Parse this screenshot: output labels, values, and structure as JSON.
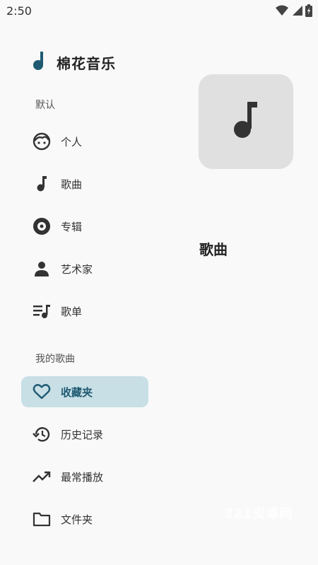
{
  "status_bar": {
    "time": "2:50"
  },
  "app": {
    "title": "棉花音乐",
    "accent_color": "#1f5a72"
  },
  "drawer": {
    "section_default": "默认",
    "default_items": [
      {
        "label": "个人",
        "icon": "face-icon"
      },
      {
        "label": "歌曲",
        "icon": "music-note-icon"
      },
      {
        "label": "专辑",
        "icon": "album-icon"
      },
      {
        "label": "艺术家",
        "icon": "person-icon"
      },
      {
        "label": "歌单",
        "icon": "playlist-icon"
      }
    ],
    "section_my": "我的歌曲",
    "my_items": [
      {
        "label": "收藏夹",
        "icon": "heart-icon",
        "active": true
      },
      {
        "label": "历史记录",
        "icon": "history-icon"
      },
      {
        "label": "最常播放",
        "icon": "trending-up-icon"
      },
      {
        "label": "文件夹",
        "icon": "folder-icon"
      }
    ]
  },
  "main": {
    "title": "歌曲",
    "art_icon": "music-note-icon"
  },
  "watermark": "221安卓网"
}
